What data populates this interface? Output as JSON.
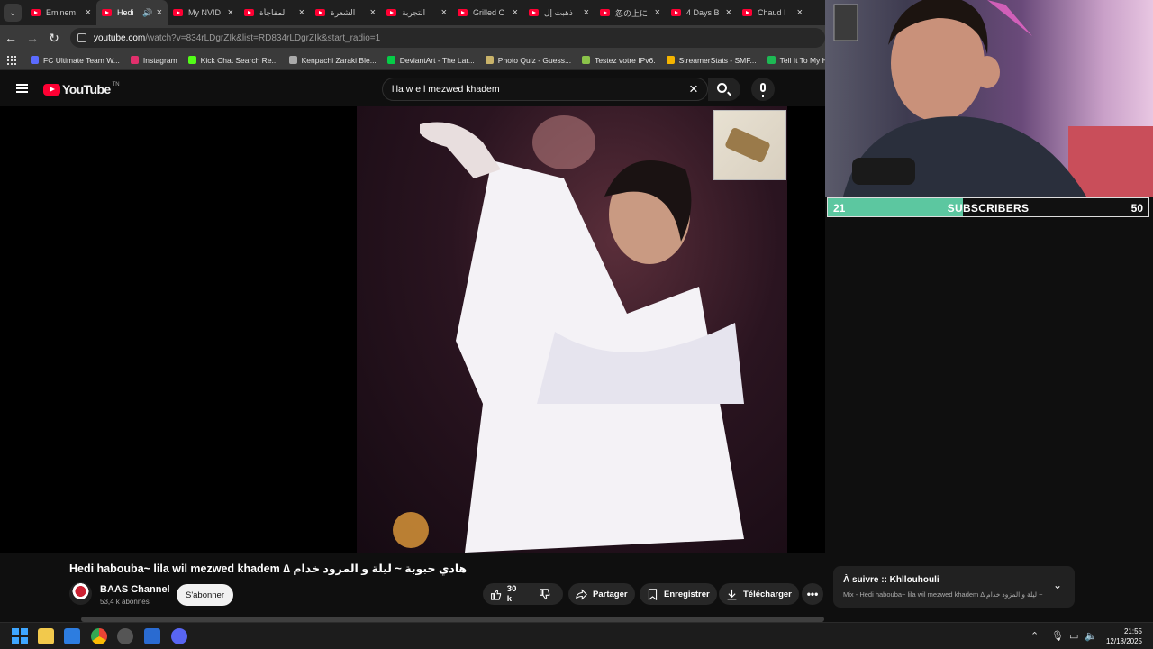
{
  "browser": {
    "tabs": [
      {
        "title": "Eminem",
        "active": false
      },
      {
        "title": "Hedi",
        "active": true,
        "audio": true
      },
      {
        "title": "My NVID",
        "active": false
      },
      {
        "title": "المفاجأة",
        "active": false
      },
      {
        "title": "الشعرة",
        "active": false
      },
      {
        "title": "التجربة",
        "active": false
      },
      {
        "title": "Grilled C",
        "active": false
      },
      {
        "title": "ذهبت إل",
        "active": false
      },
      {
        "title": "忽の上に",
        "active": false
      },
      {
        "title": "4 Days B",
        "active": false
      },
      {
        "title": "Chaud I",
        "active": false
      }
    ],
    "address": {
      "host": "youtube.com",
      "path": "/watch?v=834rLDgrZIk&list=RD834rLDgrZIk&start_radio=1"
    },
    "bookmarks": [
      {
        "label": "FC Ultimate Team W...",
        "color": "#5b6bff"
      },
      {
        "label": "Instagram",
        "color": "#e1306c"
      },
      {
        "label": "Kick Chat Search Re...",
        "color": "#53fc18"
      },
      {
        "label": "Kenpachi Zaraki Ble...",
        "color": "#aaaaaa"
      },
      {
        "label": "DeviantArt - The Lar...",
        "color": "#05cc47"
      },
      {
        "label": "Photo Quiz - Guess...",
        "color": "#c9b36a"
      },
      {
        "label": "Testez votre IPv6.",
        "color": "#8bc34a"
      },
      {
        "label": "StreamerStats - SMF...",
        "color": "#f4b400"
      },
      {
        "label": "Tell It To My Heart -...",
        "color": "#1db954"
      }
    ]
  },
  "youtube": {
    "logo_text": "YouTube",
    "logo_suffix": "TN",
    "search_query": "lila w e l mezwed khadem"
  },
  "video": {
    "title": "Hedi habouba~ lila wil mezwed khadem ∆ هادي حبوبة ~ ليلة و المزود خدام",
    "channel": "BAAS Channel",
    "subscribers": "53,4 k abonnés",
    "subscribe_label": "S'abonner",
    "likes": "30 k",
    "share_label": "Partager",
    "save_label": "Enregistrer",
    "download_label": "Télécharger"
  },
  "up_next": {
    "title": "À suivre :: Khllouhouli",
    "subtitle": "Mix - Hedi habouba~ lila wil mezwed khadem ∆ هادي حبوبة ~ ليلة و المزود خدام..."
  },
  "sub_goal": {
    "current": "21",
    "label": "SUBSCRIBERS",
    "target": "50",
    "progress": 0.42
  },
  "taskbar": {
    "time": "21:55",
    "date": "12/18/2025"
  }
}
